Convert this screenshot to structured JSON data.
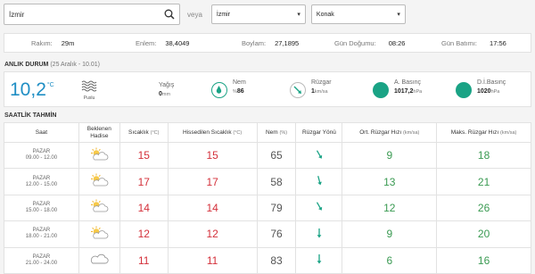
{
  "search": {
    "value": "İzmir",
    "or_label": "veya"
  },
  "selects": {
    "city": "İzmir",
    "district": "Konak"
  },
  "location": {
    "rakim_label": "Rakım:",
    "rakim": "29m",
    "enlem_label": "Enlem:",
    "enlem": "38,4049",
    "boylam_label": "Boylam:",
    "boylam": "27,1895",
    "sunrise_label": "Gün Doğumu:",
    "sunrise": "08:26",
    "sunset_label": "Gün Batımı:",
    "sunset": "17:56"
  },
  "now": {
    "title": "ANLIK DURUM",
    "date": "(25 Aralık - 10.01)",
    "temp": "10,2",
    "temp_unit": "°C",
    "condition": "Puslu",
    "rain_label": "Yağış",
    "rain_value": "0",
    "rain_unit": "mm",
    "humidity_label": "Nem",
    "humidity_prefix": "%",
    "humidity_value": "86",
    "wind_label": "Rüzgar",
    "wind_value": "1",
    "wind_unit": "km/sa",
    "pressure_label": "A. Basınç",
    "pressure_value": "1017,2",
    "pressure_unit": "hPa",
    "sea_pressure_label": "D.İ.Basınç",
    "sea_pressure_value": "1020",
    "sea_pressure_unit": "hPa",
    "accent": "#1f8ec4",
    "teal": "#1aa385"
  },
  "hourly": {
    "title": "SAATLİK TAHMİN",
    "headers": {
      "time": "Saat",
      "event": "Beklenen Hadise",
      "temp": "Sıcaklık",
      "temp_unit": "(°C)",
      "feels": "Hissedilen Sıcaklık",
      "feels_unit": "(°C)",
      "humidity": "Nem",
      "humidity_unit": "(%)",
      "wind_dir": "Rüzgar Yönü",
      "avg_wind": "Ort. Rüzgar Hızı",
      "avg_wind_unit": "(km/sa)",
      "max_wind": "Maks. Rüzgar Hızı",
      "max_wind_unit": "(km/sa)"
    },
    "rows": [
      {
        "day": "PAZAR",
        "time": "09.00 - 12.00",
        "icon": "partly-cloudy-icon",
        "temp": "15",
        "feels": "15",
        "humidity": "65",
        "wind_deg": 150,
        "avg_wind": "9",
        "max_wind": "18"
      },
      {
        "day": "PAZAR",
        "time": "12.00 - 15.00",
        "icon": "partly-cloudy-icon",
        "temp": "17",
        "feels": "17",
        "humidity": "58",
        "wind_deg": 165,
        "avg_wind": "13",
        "max_wind": "21"
      },
      {
        "day": "PAZAR",
        "time": "15.00 - 18.00",
        "icon": "partly-cloudy-icon",
        "temp": "14",
        "feels": "14",
        "humidity": "79",
        "wind_deg": 150,
        "avg_wind": "12",
        "max_wind": "26"
      },
      {
        "day": "PAZAR",
        "time": "18.00 - 21.00",
        "icon": "partly-cloudy-icon",
        "temp": "12",
        "feels": "12",
        "humidity": "76",
        "wind_deg": 180,
        "avg_wind": "9",
        "max_wind": "20"
      },
      {
        "day": "PAZAR",
        "time": "21.00 - 24.00",
        "icon": "cloudy-icon",
        "temp": "11",
        "feels": "11",
        "humidity": "83",
        "wind_deg": 180,
        "avg_wind": "6",
        "max_wind": "16"
      }
    ]
  }
}
